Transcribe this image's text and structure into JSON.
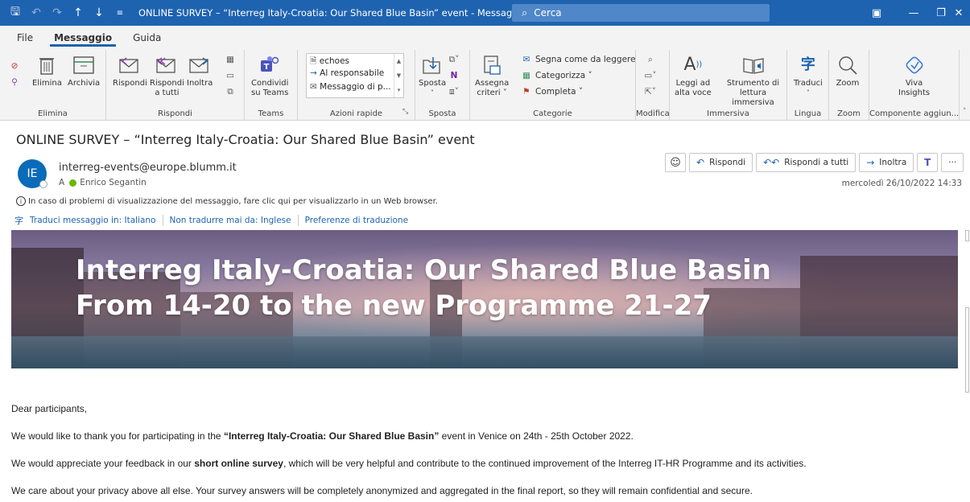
{
  "titlebar": {
    "title": "ONLINE SURVEY – “Interreg Italy-Croatia: Our Shared Blue Basin” event  -  Messaggio (HTML)",
    "search_placeholder": "Cerca"
  },
  "tabs": [
    "File",
    "Messaggio",
    "Guida"
  ],
  "ribbon": {
    "elimina": {
      "delete_label": "Elimina",
      "archive_label": "Archivia",
      "group": "Elimina"
    },
    "rispondi": {
      "reply": "Rispondi",
      "reply_all_1": "Rispondi",
      "reply_all_2": "a tutti",
      "forward": "Inoltra",
      "group": "Rispondi"
    },
    "teams": {
      "share_1": "Condividi",
      "share_2": "su Teams",
      "group": "Teams"
    },
    "azioni_rapide": {
      "items": [
        "echoes",
        "Al responsabile",
        "Messaggio di p..."
      ],
      "group": "Azioni rapide"
    },
    "sposta": {
      "move_label": "Sposta",
      "group": "Sposta"
    },
    "categorie": {
      "assign_1": "Assegna",
      "assign_2": "criteri ˅",
      "mark_read": "Segna come da leggere",
      "categorize": "Categorizza ˅",
      "complete": "Completa ˅",
      "group": "Categorie"
    },
    "modifica": {
      "group": "Modifica"
    },
    "immersiva": {
      "read_aloud_1": "Leggi ad",
      "read_aloud_2": "alta voce",
      "immersive_1": "Strumento di",
      "immersive_2": "lettura immersiva",
      "group": "Immersiva"
    },
    "lingua": {
      "translate": "Traduci",
      "group": "Lingua"
    },
    "zoom": {
      "zoom": "Zoom",
      "group": "Zoom"
    },
    "addins": {
      "viva_1": "Viva",
      "viva_2": "Insights",
      "group": "Componente aggiun..."
    }
  },
  "message": {
    "subject": "ONLINE SURVEY – “Interreg Italy-Croatia: Our Shared Blue Basin” event",
    "avatar_initials": "IE",
    "sender": "interreg-events@europe.blumm.it",
    "to_prefix": "A",
    "recipient": "Enrico Segantin",
    "date": "mercoledì 26/10/2022 14:33",
    "info_bar": "In caso di problemi di visualizzazione del messaggio, fare clic qui per visualizzarlo in un Web browser.",
    "actions": {
      "reply": "Rispondi",
      "reply_all": "Rispondi a tutti",
      "forward": "Inoltra"
    },
    "translation": {
      "translate_to": "Traduci messaggio in: Italiano",
      "never_translate": "Non tradurre mai da: Inglese",
      "prefs": "Preferenze di traduzione"
    }
  },
  "banner": {
    "line1": "Interreg Italy-Croatia: Our Shared Blue Basin",
    "line2": "From 14-20 to the new Programme 21-27"
  },
  "body": {
    "greeting": "Dear participants,",
    "p1_a": "We would like to thank you for participating in the ",
    "p1_b": "“Interreg Italy-Croatia: Our Shared Blue Basin”",
    "p1_c": " event in Venice on 24th - 25th October 2022.",
    "p2_a": "We would appreciate your feedback in our ",
    "p2_b": "short online survey",
    "p2_c": ", which will be very helpful and contribute to the continued improvement of the Interreg IT-HR Programme and its activities.",
    "p3": "We care about your privacy above all else. Your survey answers will be completely anonymized and aggregated in the final report, so they will remain confidential and secure."
  }
}
